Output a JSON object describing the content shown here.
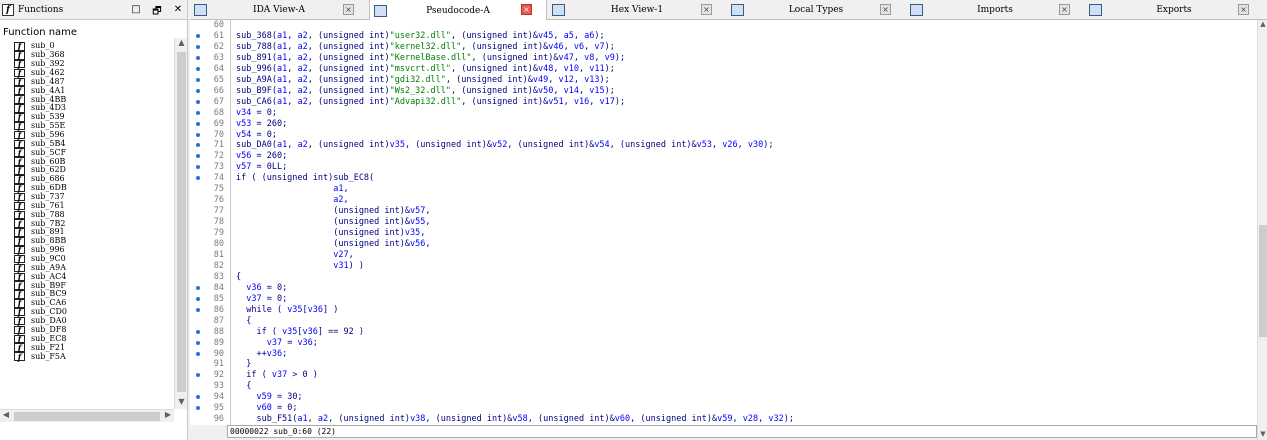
{
  "functions_panel": {
    "title": "Functions",
    "column_header": "Function name",
    "buttons": [
      "□",
      "🗗",
      "✕"
    ],
    "items": [
      "sub_0",
      "sub_368",
      "sub_392",
      "sub_462",
      "sub_487",
      "sub_4A1",
      "sub_4BB",
      "sub_4D3",
      "sub_539",
      "sub_55E",
      "sub_596",
      "sub_5B4",
      "sub_5CF",
      "sub_60B",
      "sub_62D",
      "sub_686",
      "sub_6DB",
      "sub_737",
      "sub_761",
      "sub_788",
      "sub_7B2",
      "sub_891",
      "sub_8BB",
      "sub_996",
      "sub_9C0",
      "sub_A9A",
      "sub_AC4",
      "sub_B9F",
      "sub_BC9",
      "sub_CA6",
      "sub_CD0",
      "sub_DA0",
      "sub_DF8",
      "sub_EC8",
      "sub_F21",
      "sub_F5A"
    ]
  },
  "tabs": [
    {
      "label": "IDA View-A",
      "active": false
    },
    {
      "label": "Pseudocode-A",
      "active": true
    },
    {
      "label": "Hex View-1",
      "active": false
    },
    {
      "label": "Local Types",
      "active": false
    },
    {
      "label": "Imports",
      "active": false
    },
    {
      "label": "Exports",
      "active": false
    }
  ],
  "code_lines": [
    {
      "n": "60",
      "dot": false,
      "html": ""
    },
    {
      "n": "61",
      "dot": true,
      "html": "sub_368(<span class='v'>a1</span>, <span class='v'>a2</span>, (unsigned int)<span class='s'>\"user32.dll\"</span>, (unsigned int)&amp;<span class='v'>v45</span>, <span class='v'>a5</span>, <span class='v'>a6</span>);"
    },
    {
      "n": "62",
      "dot": true,
      "html": "sub_788(<span class='v'>a1</span>, <span class='v'>a2</span>, (unsigned int)<span class='s'>\"kernel32.dll\"</span>, (unsigned int)&amp;<span class='v'>v46</span>, <span class='v'>v6</span>, <span class='v'>v7</span>);"
    },
    {
      "n": "63",
      "dot": true,
      "html": "sub_891(<span class='v'>a1</span>, <span class='v'>a2</span>, (unsigned int)<span class='s'>\"KernelBase.dll\"</span>, (unsigned int)&amp;<span class='v'>v47</span>, <span class='v'>v8</span>, <span class='v'>v9</span>);"
    },
    {
      "n": "64",
      "dot": true,
      "html": "sub_996(<span class='v'>a1</span>, <span class='v'>a2</span>, (unsigned int)<span class='s'>\"msvcrt.dll\"</span>, (unsigned int)&amp;<span class='v'>v48</span>, <span class='v'>v10</span>, <span class='v'>v11</span>);"
    },
    {
      "n": "65",
      "dot": true,
      "html": "sub_A9A(<span class='v'>a1</span>, <span class='v'>a2</span>, (unsigned int)<span class='s'>\"gdi32.dll\"</span>, (unsigned int)&amp;<span class='v'>v49</span>, <span class='v'>v12</span>, <span class='v'>v13</span>);"
    },
    {
      "n": "66",
      "dot": true,
      "html": "sub_B9F(<span class='v'>a1</span>, <span class='v'>a2</span>, (unsigned int)<span class='s'>\"Ws2_32.dll\"</span>, (unsigned int)&amp;<span class='v'>v50</span>, <span class='v'>v14</span>, <span class='v'>v15</span>);"
    },
    {
      "n": "67",
      "dot": true,
      "html": "sub_CA6(<span class='v'>a1</span>, <span class='v'>a2</span>, (unsigned int)<span class='s'>\"Advapi32.dll\"</span>, (unsigned int)&amp;<span class='v'>v51</span>, <span class='v'>v16</span>, <span class='v'>v17</span>);"
    },
    {
      "n": "68",
      "dot": true,
      "html": "<span class='v'>v34</span> = 0;"
    },
    {
      "n": "69",
      "dot": true,
      "html": "<span class='v'>v53</span> = 260;"
    },
    {
      "n": "70",
      "dot": true,
      "html": "<span class='v'>v54</span> = 0;"
    },
    {
      "n": "71",
      "dot": true,
      "html": "sub_DA0(<span class='v'>a1</span>, <span class='v'>a2</span>, (unsigned int)<span class='v'>v35</span>, (unsigned int)&amp;<span class='v'>v52</span>, (unsigned int)&amp;<span class='v'>v54</span>, (unsigned int)&amp;<span class='v'>v53</span>, <span class='v'>v26</span>, <span class='v'>v30</span>);"
    },
    {
      "n": "72",
      "dot": true,
      "html": "<span class='v'>v56</span> = 260;"
    },
    {
      "n": "73",
      "dot": true,
      "html": "<span class='v'>v57</span> = 0LL;"
    },
    {
      "n": "74",
      "dot": true,
      "html": "if ( (unsigned int)sub_EC8("
    },
    {
      "n": "75",
      "dot": false,
      "html": "                   <span class='v'>a1</span>,"
    },
    {
      "n": "76",
      "dot": false,
      "html": "                   <span class='v'>a2</span>,"
    },
    {
      "n": "77",
      "dot": false,
      "html": "                   (unsigned int)&amp;<span class='v'>v57</span>,"
    },
    {
      "n": "78",
      "dot": false,
      "html": "                   (unsigned int)&amp;<span class='v'>v55</span>,"
    },
    {
      "n": "79",
      "dot": false,
      "html": "                   (unsigned int)<span class='v'>v35</span>,"
    },
    {
      "n": "80",
      "dot": false,
      "html": "                   (unsigned int)&amp;<span class='v'>v56</span>,"
    },
    {
      "n": "81",
      "dot": false,
      "html": "                   <span class='v'>v27</span>,"
    },
    {
      "n": "82",
      "dot": false,
      "html": "                   <span class='v'>v31</span>) )"
    },
    {
      "n": "83",
      "dot": false,
      "html": "{"
    },
    {
      "n": "84",
      "dot": true,
      "html": "  <span class='v'>v36</span> = 0;"
    },
    {
      "n": "85",
      "dot": true,
      "html": "  <span class='v'>v37</span> = 0;"
    },
    {
      "n": "86",
      "dot": true,
      "html": "  while ( <span class='v'>v35</span>[<span class='v'>v36</span>] )"
    },
    {
      "n": "87",
      "dot": false,
      "html": "  {"
    },
    {
      "n": "88",
      "dot": true,
      "html": "    if ( <span class='v'>v35</span>[<span class='v'>v36</span>] == 92 )"
    },
    {
      "n": "89",
      "dot": true,
      "html": "      <span class='v'>v37</span> = <span class='v'>v36</span>;"
    },
    {
      "n": "90",
      "dot": true,
      "html": "    ++<span class='v'>v36</span>;"
    },
    {
      "n": "91",
      "dot": false,
      "html": "  }"
    },
    {
      "n": "92",
      "dot": true,
      "html": "  if ( <span class='v'>v37</span> &gt; 0 )"
    },
    {
      "n": "93",
      "dot": false,
      "html": "  {"
    },
    {
      "n": "94",
      "dot": true,
      "html": "    <span class='v'>v59</span> = 30;"
    },
    {
      "n": "95",
      "dot": true,
      "html": "    <span class='v'>v60</span> = 0;"
    },
    {
      "n": "96",
      "dot": false,
      "html": "    sub_F51(<span class='v'>a1</span>, <span class='v'>a2</span>, (unsigned int)<span class='v'>v38</span>, (unsigned int)&amp;<span class='v'>v58</span>, (unsigned int)&amp;<span class='v'>v60</span>, (unsigned int)&amp;<span class='v'>v59</span>, <span class='v'>v28</span>, <span class='v'>v32</span>);"
    }
  ],
  "status": "00000022 sub_0:60 (22)"
}
